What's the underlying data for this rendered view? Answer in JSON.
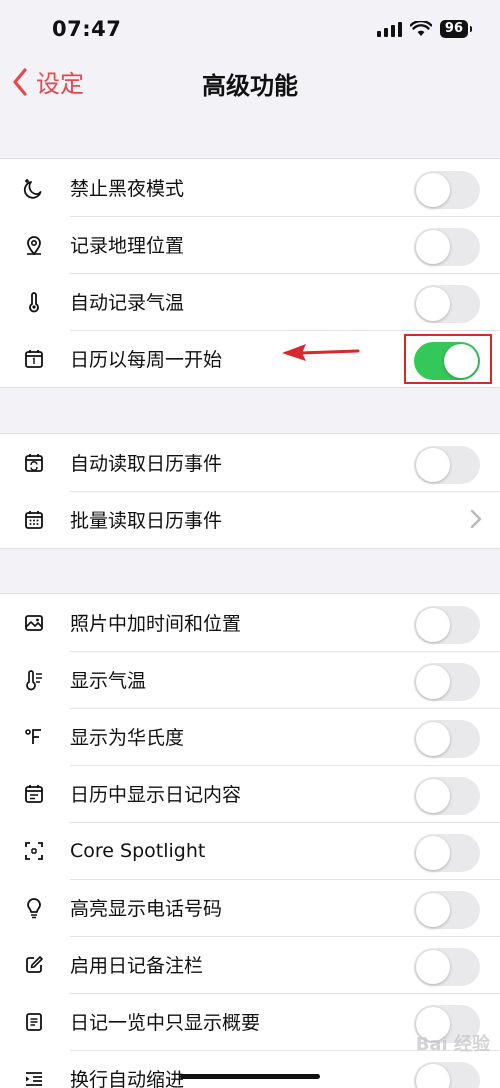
{
  "status": {
    "time": "07:47",
    "battery": "96"
  },
  "nav": {
    "back_label": "设定",
    "title": "高级功能"
  },
  "groups": [
    {
      "items": [
        {
          "label": "禁止黑夜模式",
          "icon": "moon-icon",
          "control": "toggle",
          "on": false
        },
        {
          "label": "记录地理位置",
          "icon": "location-pin-icon",
          "control": "toggle",
          "on": false
        },
        {
          "label": "自动记录气温",
          "icon": "thermometer-icon",
          "control": "toggle",
          "on": false
        },
        {
          "label": "日历以每周一开始",
          "icon": "calendar-icon",
          "control": "toggle",
          "on": true,
          "highlighted": true
        }
      ]
    },
    {
      "items": [
        {
          "label": "自动读取日历事件",
          "icon": "calendar-sync-icon",
          "control": "toggle",
          "on": false
        },
        {
          "label": "批量读取日历事件",
          "icon": "calendar-grid-icon",
          "control": "chevron"
        }
      ]
    },
    {
      "items": [
        {
          "label": "照片中加时间和位置",
          "icon": "photo-icon",
          "control": "toggle",
          "on": false
        },
        {
          "label": "显示气温",
          "icon": "temperature-icon",
          "control": "toggle",
          "on": false
        },
        {
          "label": "显示为华氏度",
          "icon": "fahrenheit-icon",
          "control": "toggle",
          "on": false
        },
        {
          "label": "日历中显示日记内容",
          "icon": "calendar-note-icon",
          "control": "toggle",
          "on": false
        },
        {
          "label": "Core Spotlight",
          "icon": "spotlight-icon",
          "control": "toggle",
          "on": false
        },
        {
          "label": "高亮显示电话号码",
          "icon": "lightbulb-icon",
          "control": "toggle",
          "on": false
        },
        {
          "label": "启用日记备注栏",
          "icon": "edit-note-icon",
          "control": "toggle",
          "on": false
        },
        {
          "label": "日记一览中只显示概要",
          "icon": "summary-list-icon",
          "control": "toggle",
          "on": false
        },
        {
          "label": "换行自动缩进",
          "icon": "indent-icon",
          "control": "toggle",
          "on": false
        }
      ]
    }
  ],
  "colors": {
    "accent": "#e5484d",
    "toggle_on": "#34c759",
    "annotation": "#d9272e"
  },
  "watermark": "Bai 经验"
}
